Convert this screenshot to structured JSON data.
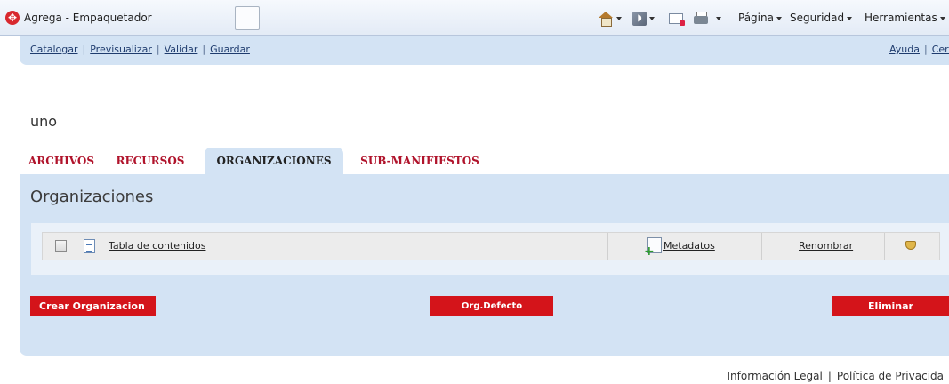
{
  "browser": {
    "tab_title": "Agrega - Empaquetador",
    "page_menu": "Página",
    "safety_menu": "Seguridad",
    "tools_menu": "Herramientas"
  },
  "toolbar": {
    "catalog": "Catalogar",
    "preview": "Previsualizar",
    "validate": "Validar",
    "save": "Guardar",
    "help": "Ayuda",
    "close": "Cerr"
  },
  "document": {
    "title": "uno"
  },
  "tabs": [
    {
      "label": "ARCHIVOS",
      "active": false
    },
    {
      "label": "RECURSOS",
      "active": false
    },
    {
      "label": "ORGANIZACIONES",
      "active": true
    },
    {
      "label": "SUB-MANIFIESTOS",
      "active": false
    }
  ],
  "panel": {
    "title": "Organizaciones",
    "rows": [
      {
        "name": "Tabla de contenidos",
        "metadata_label": "Metadatos",
        "rename_label": "Renombrar",
        "checked": false
      }
    ]
  },
  "buttons": {
    "create": "Crear Organizacion",
    "default": "Org.Defecto",
    "delete": "Eliminar"
  },
  "footer": {
    "legal": "Información Legal",
    "privacy": "Política de Privacida"
  },
  "colors": {
    "accent": "#d4141a",
    "panel": "#d3e3f4",
    "tab_text": "#b0132b"
  },
  "icons": {
    "favicon": "agrega-logo-icon",
    "home": "home-icon",
    "feeds": "rss-icon",
    "mail": "mail-icon",
    "print": "print-icon",
    "row": "document-icon",
    "metadata": "add-metadata-icon",
    "clean": "brush-icon"
  }
}
